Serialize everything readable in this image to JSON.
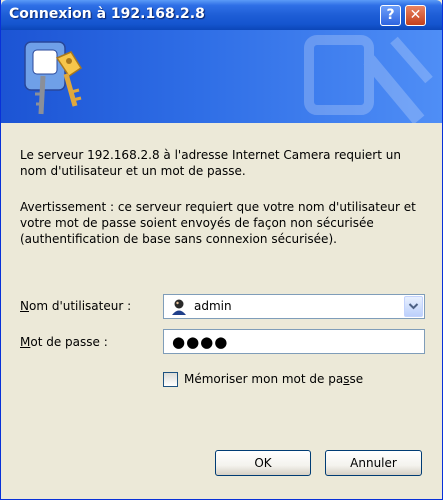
{
  "window": {
    "title": "Connexion à 192.168.2.8",
    "help_label": "?",
    "close_label": "✕"
  },
  "message": {
    "line1": "Le serveur 192.168.2.8 à l'adresse Internet Camera requiert un nom d'utilisateur et un mot de passe.",
    "warning": "Avertissement : ce serveur requiert que votre nom d'utilisateur et votre mot de passe soient envoyés de façon non sécurisée (authentification de base sans connexion sécurisée)."
  },
  "form": {
    "username_label_key": "N",
    "username_label_rest": "om d'utilisateur :",
    "username_value": "admin",
    "password_label_key": "M",
    "password_label_rest": "ot de passe :",
    "password_value": "●●●●",
    "remember_label_pre": "Mémoriser mon mot de pa",
    "remember_label_key": "s",
    "remember_label_post": "se",
    "remember_checked": false
  },
  "buttons": {
    "ok": "OK",
    "cancel": "Annuler"
  },
  "icons": {
    "banner": "keys-icon",
    "user": "user-icon",
    "dropdown": "chevron-down-icon"
  },
  "colors": {
    "title_bar": "#1e5ed6",
    "banner": "#2f6ee6",
    "dialog_bg": "#ece9d8"
  }
}
